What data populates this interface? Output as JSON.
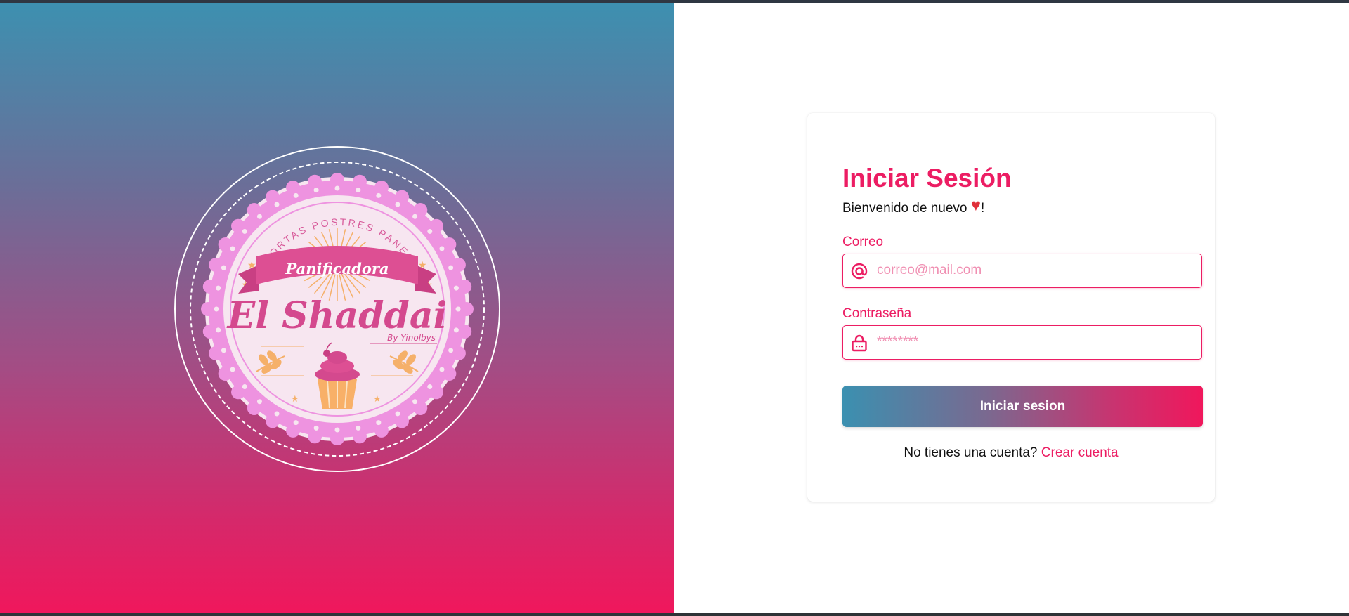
{
  "brand": {
    "arc_text": "TORTAS POSTRES PANES",
    "ribbon_text": "Panificadora",
    "name": "El Shaddai",
    "byline": "By Yinolbys"
  },
  "login": {
    "title": "Iniciar Sesión",
    "welcome_prefix": "Bienvenido de nuevo ",
    "welcome_heart": "♥",
    "welcome_suffix": "!",
    "email": {
      "label": "Correo",
      "placeholder": "correo@mail.com",
      "value": ""
    },
    "password": {
      "label": "Contraseña",
      "placeholder": "********",
      "value": ""
    },
    "submit_label": "Iniciar sesion",
    "signup_prompt": "No tienes una cuenta? ",
    "signup_link": "Crear cuenta"
  },
  "colors": {
    "accent": "#ec1d63",
    "gradient_start": "#3d90b0",
    "gradient_end": "#f0175c",
    "heart": "#e0303a"
  },
  "icons": {
    "email": "at-sign-icon",
    "password": "lock-icon"
  }
}
